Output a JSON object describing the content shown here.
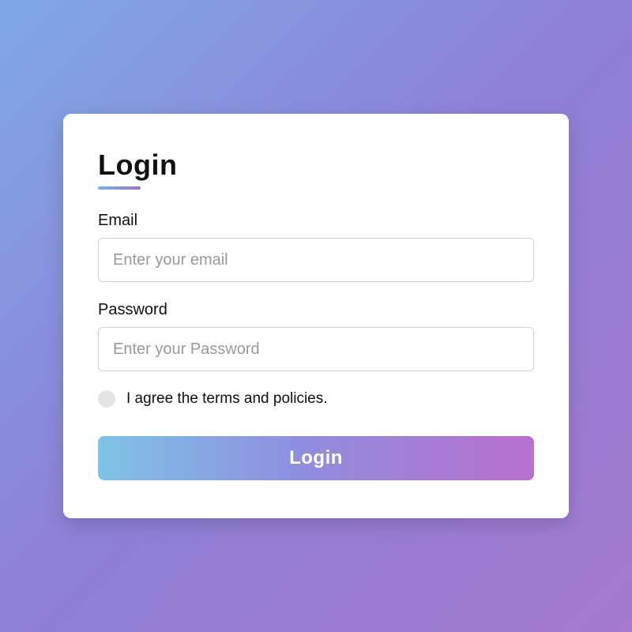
{
  "title": "Login",
  "fields": {
    "email": {
      "label": "Email",
      "placeholder": "Enter your email",
      "value": ""
    },
    "password": {
      "label": "Password",
      "placeholder": "Enter your Password",
      "value": ""
    }
  },
  "terms": {
    "label": "I agree the terms and policies.",
    "checked": false
  },
  "submit_label": "Login"
}
